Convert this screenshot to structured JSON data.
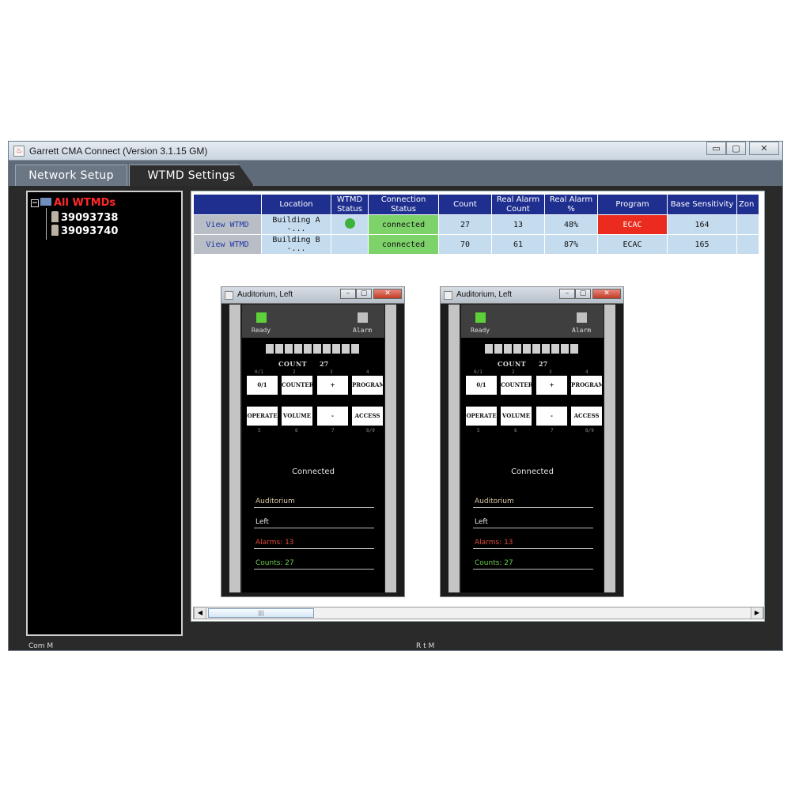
{
  "window": {
    "title": "Garrett CMA Connect (Version 3.1.15 GM)",
    "icon": "java-app-icon",
    "controls": {
      "minimize": "▭",
      "maximize": "▢",
      "close": "✕"
    }
  },
  "tabs": [
    {
      "label": "Network Setup",
      "active": false
    },
    {
      "label": "WTMD Settings",
      "active": true
    }
  ],
  "tree": {
    "root_label": "All WTMDs",
    "expander": "⊟",
    "children": [
      {
        "label": "39093738"
      },
      {
        "label": "39093740"
      }
    ]
  },
  "grid": {
    "columns": [
      "",
      "Location",
      "WTMD Status",
      "Connection Status",
      "Count",
      "Real Alarm Count",
      "Real Alarm %",
      "Program",
      "Base Sensitivity",
      "Zon"
    ],
    "rows": [
      {
        "action": "View WTMD",
        "location": "Building A -...",
        "wtmd_status": "green-dot",
        "connection": "connected",
        "count": "27",
        "real_alarm_count": "13",
        "real_alarm_pct": "48%",
        "program": "ECAC",
        "base_sensitivity": "164",
        "zone": ""
      },
      {
        "action": "View WTMD",
        "location": "Building B -...",
        "wtmd_status": "",
        "connection": "connected",
        "count": "70",
        "real_alarm_count": "61",
        "real_alarm_pct": "87%",
        "program": "ECAC",
        "base_sensitivity": "165",
        "zone": ""
      }
    ],
    "colors": {
      "header": "#1f2f8f",
      "cell": "#c5dcef",
      "connected": "#7ed26a",
      "program_alert": "#ea2b1d"
    }
  },
  "panels": [
    {
      "title": "Auditorium, Left",
      "ready_label": "Ready",
      "alarm_label": "Alarm",
      "count_label": "COUNT",
      "count_value": "27",
      "keys": [
        "0/1",
        "COUNTER",
        "+",
        "PROGRAM",
        "OPERATE",
        "VOLUME",
        "-",
        "ACCESS"
      ],
      "key_numbers_top": [
        "0/1",
        "2",
        "3",
        "4"
      ],
      "key_numbers_bottom": [
        "5",
        "6",
        "7",
        "8/9"
      ],
      "connection": "Connected",
      "location": "Auditorium",
      "side": "Left",
      "alarms": "Alarms: 13",
      "counts": "Counts: 27"
    },
    {
      "title": "Auditorium, Left",
      "ready_label": "Ready",
      "alarm_label": "Alarm",
      "count_label": "COUNT",
      "count_value": "27",
      "keys": [
        "0/1",
        "COUNTER",
        "+",
        "PROGRAM",
        "OPERATE",
        "VOLUME",
        "-",
        "ACCESS"
      ],
      "key_numbers_top": [
        "0/1",
        "2",
        "3",
        "4"
      ],
      "key_numbers_bottom": [
        "5",
        "6",
        "7",
        "8/9"
      ],
      "connection": "Connected",
      "location": "Auditorium",
      "side": "Left",
      "alarms": "Alarms: 13",
      "counts": "Counts: 27"
    }
  ],
  "scrollbar": {
    "left_arrow": "◀",
    "right_arrow": "▶",
    "thumb_grip": "|||"
  },
  "statusbar": {
    "left": "Com M",
    "right": "R t M"
  }
}
